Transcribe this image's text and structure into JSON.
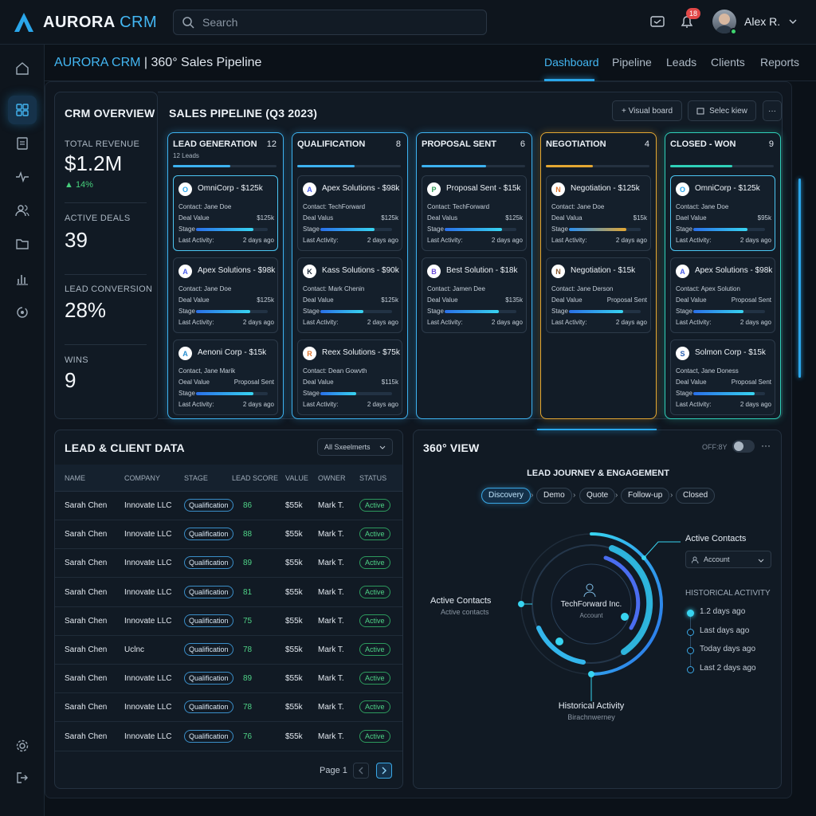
{
  "app": {
    "brand": "AURORA",
    "brand_suffix": "CRM"
  },
  "search": {
    "placeholder": "Search"
  },
  "notifications": {
    "count": "18"
  },
  "user": {
    "name": "Alex R."
  },
  "header": {
    "title_brand": "AURORA CRM",
    "title_rest": " | 360° Sales Pipeline",
    "tabs": [
      "Dashboard",
      "Pipeline",
      "Leads",
      "Clients",
      "Reports"
    ],
    "active_tab": "Dashboard"
  },
  "overview": {
    "title": "CRM OVERVIEW",
    "stats": [
      {
        "label": "TOTAL REVENUE",
        "value": "$1.2M",
        "sub": "▲ 14%"
      },
      {
        "label": "ACTIVE DEALS",
        "value": "39"
      },
      {
        "label": "LEAD CONVERSION",
        "value": "28%"
      },
      {
        "label": "WINS",
        "value": "9"
      }
    ]
  },
  "pipeline": {
    "title": "SALES PIPELINE (Q3 2023)",
    "buttons": [
      "+ Visual board",
      "Selec kiew"
    ],
    "columns": [
      {
        "title": "LEAD GENERATION",
        "count": "12",
        "sub": "12 Leads",
        "color": "#3db2f0",
        "fill": 0.55,
        "cards": [
          {
            "title": "OmniCorp - $125k",
            "contact": "Contact: Jane Doe",
            "deal_label": "Deal Value",
            "deal": "$125k",
            "stage_fill": 0.8,
            "last": "2 days ago",
            "logo": "O",
            "logo_color": "#2aa6ea"
          },
          {
            "title": "Apex Solutions - $98k",
            "contact": "Contact: Jane Doe",
            "deal_label": "Deal Value",
            "deal": "$125k",
            "stage_fill": 0.75,
            "last": "2 days ago",
            "logo": "A",
            "logo_color": "#4a5de8"
          },
          {
            "title": "Aenoni Corp - $15k",
            "contact": "Contact, Jane Marik",
            "deal_label": "Oeal Value",
            "deal": "Proposal Sent",
            "stage_fill": 0.8,
            "last": "2 days ago",
            "logo": "A",
            "logo_color": "#2a8fd0"
          }
        ]
      },
      {
        "title": "QUALIFICATION",
        "count": "8",
        "sub": "",
        "color": "#3db2f0",
        "fill": 0.55,
        "cards": [
          {
            "title": "Apex Solutions - $98k",
            "contact": "Contact: TechForward",
            "deal_label": "Deal Valus",
            "deal": "$125k",
            "stage_fill": 0.75,
            "last": "2 days ago",
            "logo": "A",
            "logo_color": "#4a5de8"
          },
          {
            "title": "Kass Solutions - $90k",
            "contact": "Contact: Mark Chenin",
            "deal_label": "Deal Value",
            "deal": "$125k",
            "stage_fill": 0.6,
            "last": "2 days ago",
            "logo": "K",
            "logo_color": "#1d2b3a"
          },
          {
            "title": "Reex Solutions - $75k",
            "contact": "Contact: Dean Gowvth",
            "deal_label": "Deal Value",
            "deal": "$115k",
            "stage_fill": 0.5,
            "last": "2 days ago",
            "logo": "R",
            "logo_color": "#e0772f"
          }
        ]
      },
      {
        "title": "PROPOSAL SENT",
        "count": "6",
        "sub": "",
        "color": "#3db2f0",
        "fill": 0.62,
        "cards": [
          {
            "title": "Proposal Sent - $15k",
            "contact": "Contact: TechForward",
            "deal_label": "Deal Valus",
            "deal": "$125k",
            "stage_fill": 0.8,
            "last": "2 days ago",
            "logo": "P",
            "logo_color": "#2e9a57"
          },
          {
            "title": "Best Solution - $18k",
            "contact": "Contact: Jamen Dee",
            "deal_label": "Deal Value",
            "deal": "$135k",
            "stage_fill": 0.75,
            "last": "2 days ago",
            "logo": "B",
            "logo_color": "#6a4bd8"
          }
        ]
      },
      {
        "title": "NEGOTIATION",
        "count": "4",
        "sub": "",
        "color": "#e3a732",
        "fill": 0.45,
        "cards": [
          {
            "title": "Negotiation - $125k",
            "contact": "Contact: Jane Doe",
            "deal_label": "Deal Valua",
            "deal": "$15k",
            "stage_fill": 0.8,
            "last": "2 days ago",
            "logo": "N",
            "logo_color": "#e0772f",
            "stage_color": "#e3a732"
          },
          {
            "title": "Negotiation - $15k",
            "contact": "Contact: Jane Derson",
            "deal_label": "Deal Value",
            "deal": "Proposal Sent",
            "stage_fill": 0.75,
            "last": "2 days ago",
            "logo": "N",
            "logo_color": "#8a5a30"
          }
        ]
      },
      {
        "title": "CLOSED - WON",
        "count": "9",
        "sub": "",
        "color": "#2fd0b8",
        "fill": 0.6,
        "cards": [
          {
            "title": "OmniCorp - $125k",
            "contact": "Contact: Jane Doe",
            "deal_label": "Dael Value",
            "deal": "$95k",
            "stage_fill": 0.75,
            "last": "2 days ago",
            "logo": "O",
            "logo_color": "#2aa6ea"
          },
          {
            "title": "Apex Solutions - $98k",
            "contact": "Contact: Apex Solution",
            "deal_label": "Deal Value",
            "deal": "Proposal Sent",
            "stage_fill": 0.7,
            "last": "2 days ago",
            "logo": "A",
            "logo_color": "#4a5de8"
          },
          {
            "title": "Solmon Corp - $15k",
            "contact": "Contact, Jane Doness",
            "deal_label": "Deal Value",
            "deal": "Proposal Sent",
            "stage_fill": 0.85,
            "last": "2 days ago",
            "logo": "S",
            "logo_color": "#2a5fb0"
          }
        ]
      }
    ],
    "card_labels": {
      "stage": "Stage",
      "last": "Last Activity:"
    }
  },
  "leads": {
    "title": "LEAD & CLIENT DATA",
    "filter": "All Sxeelmerts",
    "headers": [
      "NAME",
      "COMPANY",
      "STAGE",
      "LEAD SCORE",
      "VALUE",
      "OWNER",
      "STATUS"
    ],
    "rows": [
      [
        "Sarah Chen",
        "Innovate LLC",
        "Qualification",
        "86",
        "$55k",
        "Mark T.",
        "Active"
      ],
      [
        "Sarah Chen",
        "Innovate LLC",
        "Qualification",
        "88",
        "$55k",
        "Mark T.",
        "Active"
      ],
      [
        "Sarah Chen",
        "Innovate LLC",
        "Qualification",
        "89",
        "$55k",
        "Mark T.",
        "Active"
      ],
      [
        "Sarah Chen",
        "Innovate LLC",
        "Qualification",
        "81",
        "$55k",
        "Mark T.",
        "Active"
      ],
      [
        "Sarah Chen",
        "Innovate LLC",
        "Qualification",
        "75",
        "$55k",
        "Mark T.",
        "Active"
      ],
      [
        "Sarah Chen",
        "Uclnc",
        "Qualification",
        "78",
        "$55k",
        "Mark T.",
        "Active"
      ],
      [
        "Sarah Chen",
        "Innovate LLC",
        "Qualification",
        "89",
        "$55k",
        "Mark T.",
        "Active"
      ],
      [
        "Sarah Chen",
        "Innovate LLC",
        "Qualification",
        "78",
        "$55k",
        "Mark T.",
        "Active"
      ],
      [
        "Sarah Chen",
        "Innovate LLC",
        "Qualification",
        "76",
        "$55k",
        "Mark T.",
        "Active"
      ]
    ],
    "page_label": "Page 1"
  },
  "view360": {
    "title": "360° VIEW",
    "toggle_label": "OFF:8Y",
    "journey_title": "LEAD JOURNEY & ENGAGEMENT",
    "steps": [
      "Discovery",
      "Demo",
      "Quote",
      "Follow-up",
      "Closed"
    ],
    "active_step": "Discovery",
    "center_name": "TechForward Inc.",
    "center_sub": "Account",
    "left_label": "Active Contacts",
    "left_sub": "Active contacts",
    "right_label": "Active Contacts",
    "account_select": "Account",
    "bottom_label": "Historical Activity",
    "bottom_sub": "Birachnwerney",
    "history_title": "HISTORICAL ACTIVITY",
    "history": [
      "1.2 days ago",
      "Last days ago",
      "Today days ago",
      "Last 2 days ago"
    ]
  }
}
